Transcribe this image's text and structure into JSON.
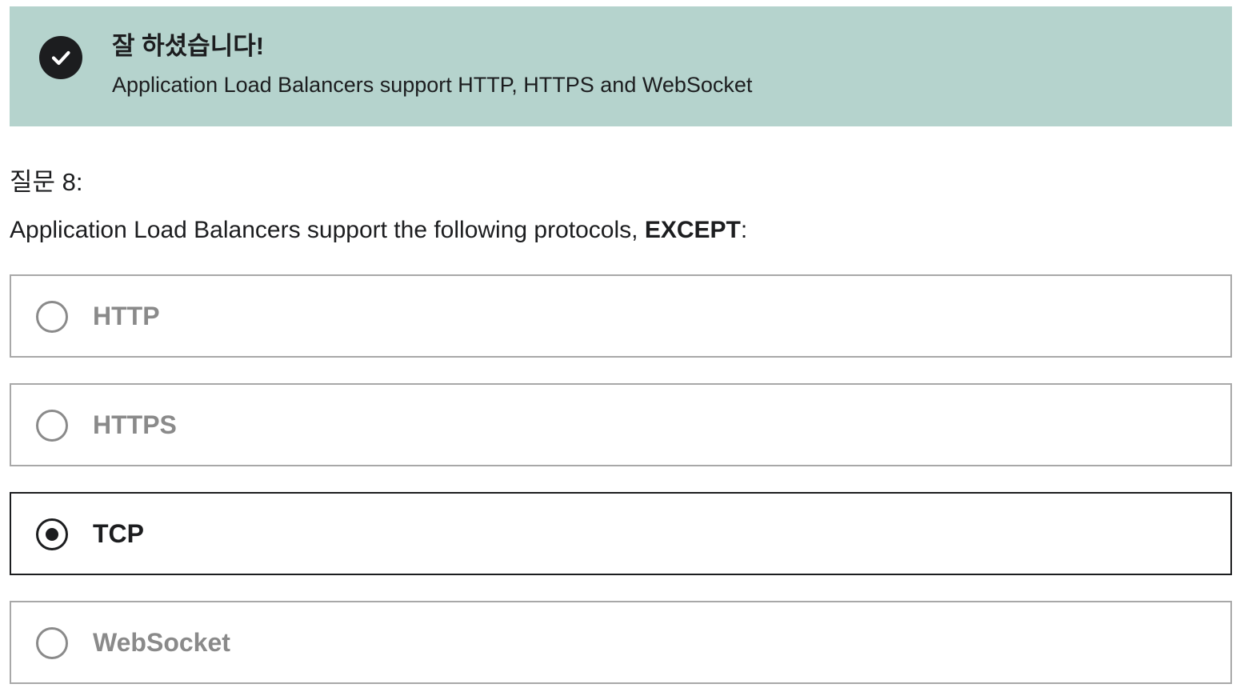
{
  "banner": {
    "title": "잘 하셨습니다!",
    "message": "Application Load Balancers support HTTP, HTTPS and WebSocket",
    "icon": "check-circle-icon",
    "background_color": "#b5d3cd"
  },
  "question": {
    "number_label": "질문 8:",
    "text_prefix": "Application Load Balancers support the following protocols, ",
    "text_emphasis": "EXCEPT",
    "text_suffix": ":"
  },
  "options": [
    {
      "label": "HTTP",
      "selected": false
    },
    {
      "label": "HTTPS",
      "selected": false
    },
    {
      "label": "TCP",
      "selected": true
    },
    {
      "label": "WebSocket",
      "selected": false
    }
  ]
}
